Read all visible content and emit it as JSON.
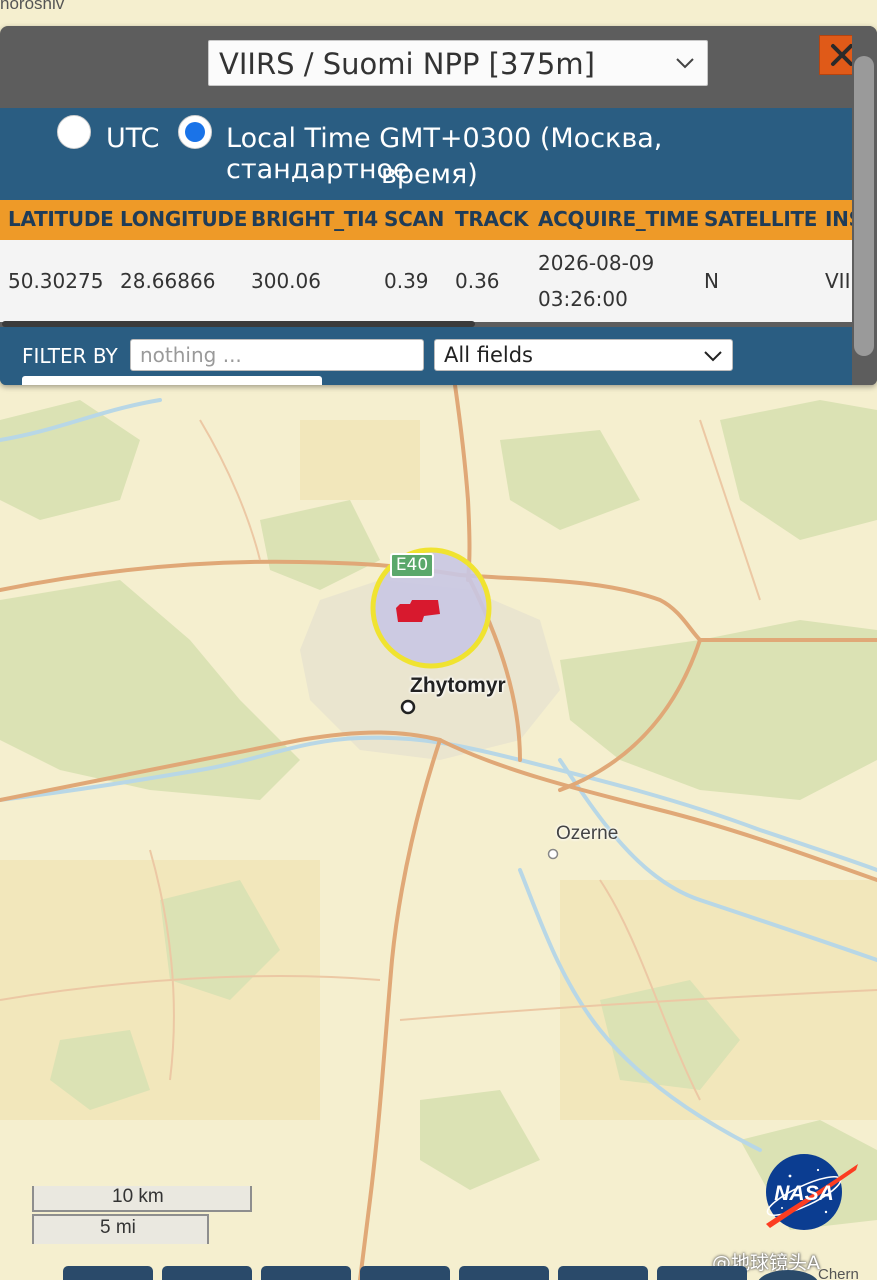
{
  "map": {
    "city": "Zhytomyr",
    "town": "Ozerne",
    "road_shield": "E40",
    "corner_town_top": "noroshiv",
    "corner_town_bottom": "Chern",
    "fire_highlight_color": "#d8192e",
    "highlight_ring_color": "#f0e330"
  },
  "panel": {
    "sensor_select": "VIIRS / Suomi NPP [375m]",
    "close_icon": "close-icon",
    "time": {
      "utc_label": "UTC",
      "local_label_line1": "Local Time GMT+0300 (Москва, стандартное",
      "local_label_line2": "время)",
      "selected": "local"
    },
    "table": {
      "headers": [
        "LATITUDE",
        "LONGITUDE",
        "BRIGHT_TI4",
        "SCAN",
        "TRACK",
        "ACQUIRE_TIME",
        "SATELLITE",
        "INS"
      ],
      "row": {
        "latitude": "50.30275",
        "longitude": "28.66866",
        "bright_ti4": "300.06",
        "scan": "0.39",
        "track": "0.36",
        "acquire_date": "2026-08-09",
        "acquire_time": "03:26:00",
        "satellite": "N",
        "instrument": "VII"
      }
    },
    "filter": {
      "label": "FILTER BY",
      "placeholder": "nothing ...",
      "fields_select": "All fields"
    }
  },
  "scale": {
    "km": "10 km",
    "mi": "5 mi"
  },
  "logo": {
    "text": "NASA"
  },
  "watermark": "@地球镜头A",
  "colors": {
    "header_blue": "#2a5d82",
    "header_orange": "#ee9a28",
    "close_orange": "#e05a18",
    "radio_selected": "#1a73e8"
  }
}
